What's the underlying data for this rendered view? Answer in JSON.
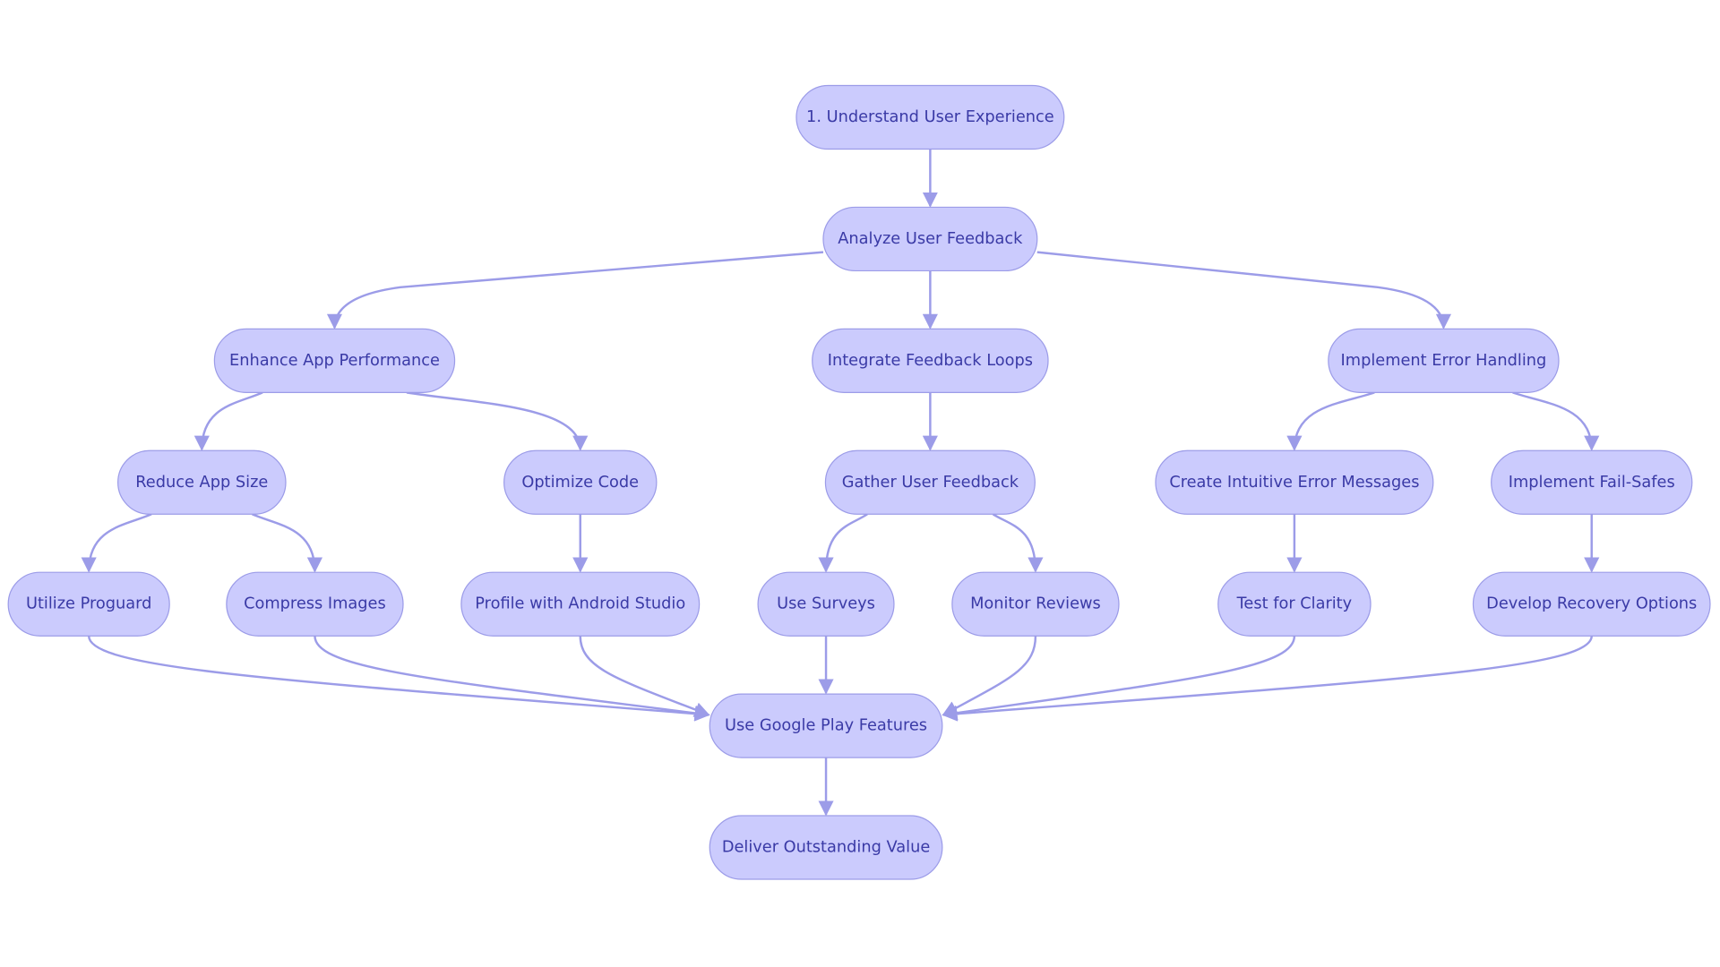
{
  "colors": {
    "node_fill": "#cbcbfd",
    "node_border": "#9c9ce8",
    "text": "#3a3aa6",
    "edge": "#9c9ce8"
  },
  "nodes": [
    {
      "id": "n1",
      "label": "1. Understand User Experience"
    },
    {
      "id": "n2",
      "label": "Analyze User Feedback"
    },
    {
      "id": "n3",
      "label": "Enhance App Performance"
    },
    {
      "id": "n4",
      "label": "Integrate Feedback Loops"
    },
    {
      "id": "n5",
      "label": "Implement Error Handling"
    },
    {
      "id": "n6",
      "label": "Reduce App Size"
    },
    {
      "id": "n7",
      "label": "Optimize Code"
    },
    {
      "id": "n8",
      "label": "Gather User Feedback"
    },
    {
      "id": "n9",
      "label": "Create Intuitive Error Messages"
    },
    {
      "id": "n10",
      "label": "Implement Fail-Safes"
    },
    {
      "id": "n11",
      "label": "Utilize Proguard"
    },
    {
      "id": "n12",
      "label": "Compress Images"
    },
    {
      "id": "n13",
      "label": "Profile with Android Studio"
    },
    {
      "id": "n14",
      "label": "Use Surveys"
    },
    {
      "id": "n15",
      "label": "Monitor Reviews"
    },
    {
      "id": "n16",
      "label": "Test for Clarity"
    },
    {
      "id": "n17",
      "label": "Develop Recovery Options"
    },
    {
      "id": "n18",
      "label": "Use Google Play Features"
    },
    {
      "id": "n19",
      "label": "Deliver Outstanding Value"
    }
  ],
  "edges": [
    [
      "n1",
      "n2"
    ],
    [
      "n2",
      "n3"
    ],
    [
      "n2",
      "n4"
    ],
    [
      "n2",
      "n5"
    ],
    [
      "n3",
      "n6"
    ],
    [
      "n3",
      "n7"
    ],
    [
      "n4",
      "n8"
    ],
    [
      "n5",
      "n9"
    ],
    [
      "n5",
      "n10"
    ],
    [
      "n6",
      "n11"
    ],
    [
      "n6",
      "n12"
    ],
    [
      "n7",
      "n13"
    ],
    [
      "n8",
      "n14"
    ],
    [
      "n8",
      "n15"
    ],
    [
      "n9",
      "n16"
    ],
    [
      "n10",
      "n17"
    ],
    [
      "n11",
      "n18"
    ],
    [
      "n12",
      "n18"
    ],
    [
      "n13",
      "n18"
    ],
    [
      "n14",
      "n18"
    ],
    [
      "n15",
      "n18"
    ],
    [
      "n16",
      "n18"
    ],
    [
      "n17",
      "n18"
    ],
    [
      "n18",
      "n19"
    ]
  ]
}
